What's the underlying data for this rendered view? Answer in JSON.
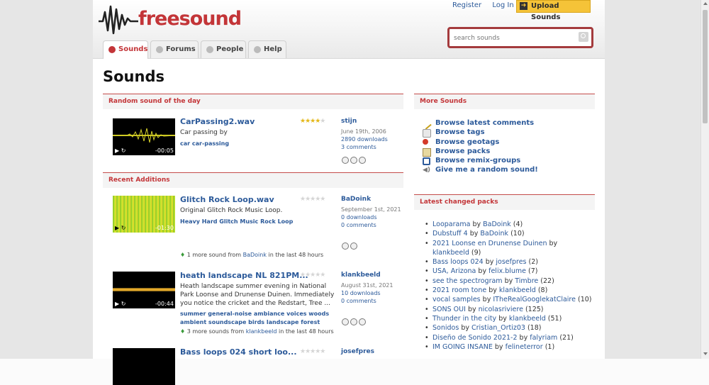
{
  "brand": {
    "logo_text": "freesound",
    "accent_color": "#c33538",
    "link_color": "#2c5a9a"
  },
  "top_links": {
    "register": "Register",
    "login": "Log In",
    "upload": "Upload Sounds"
  },
  "search": {
    "placeholder": "search sounds",
    "icon": "magnifier-icon"
  },
  "tabs": [
    {
      "label": "Sounds",
      "icon": "headphones-icon",
      "active": true
    },
    {
      "label": "Forums",
      "icon": "speech-bubble-icon",
      "active": false
    },
    {
      "label": "People",
      "icon": "people-icon",
      "active": false
    },
    {
      "label": "Help",
      "icon": "question-icon",
      "active": false
    }
  ],
  "page_title": "Sounds",
  "random_sound": {
    "heading": "Random sound of the day",
    "title": "CarPassing2.wav",
    "description": "Car passing by",
    "tags": "car car-passing",
    "user": "stijn",
    "date": "June 19th, 2006",
    "downloads": "2890 downloads",
    "comments": "3 comments",
    "duration": "-00:05",
    "rating": 4
  },
  "recent": {
    "heading": "Recent Additions",
    "items": [
      {
        "title": "Glitch Rock Loop.wav",
        "description": "Original Glitch Rock Music Loop.",
        "tags": "Heavy Hard Glitch Music Rock Loop",
        "user": "BaDoink",
        "date": "September 1st, 2021",
        "downloads": "0 downloads",
        "comments": "0 comments",
        "duration": "-01:30",
        "rating": 0,
        "more": {
          "count": "1 more sound from",
          "user": "BaDoink",
          "suffix": "in the last 48 hours"
        }
      },
      {
        "title": "heath landscape NL 821PM...",
        "description": "Heath landscape summer evening in National Park Loonse and Drunense Duinen. Immediately you notice the cricket and the Redstart, Tree ...",
        "tags": "summer general-noise ambiance voices woods ambient soundscape birds landscape forest",
        "user": "klankbeeld",
        "date": "August 31st, 2021",
        "downloads": "10 downloads",
        "comments": "0 comments",
        "duration": "-00:44",
        "rating": 0,
        "more": {
          "count": "3 more sounds from",
          "user": "klankbeeld",
          "suffix": "in the last 48 hours"
        }
      },
      {
        "title": "Bass loops 024 short loo...",
        "user": "josefpres",
        "rating": 0
      }
    ]
  },
  "more_sounds": {
    "heading": "More Sounds",
    "links": [
      {
        "label": "Browse latest comments",
        "icon": "pencil-icon"
      },
      {
        "label": "Browse tags",
        "icon": "tag-icon"
      },
      {
        "label": "Browse geotags",
        "icon": "pin-icon"
      },
      {
        "label": "Browse packs",
        "icon": "pack-icon"
      },
      {
        "label": "Browse remix-groups",
        "icon": "remix-icon"
      },
      {
        "label": "Give me a random sound!",
        "icon": "speaker-icon"
      }
    ]
  },
  "packs": {
    "heading": "Latest changed packs",
    "items": [
      {
        "name": "Looparama",
        "user": "BaDoink",
        "count": "(4)"
      },
      {
        "name": "Dubstuff 4",
        "user": "BaDoink",
        "count": "(10)"
      },
      {
        "name": "2021 Loonse en Drunense Duinen",
        "user": "klankbeeld",
        "count": "(9)"
      },
      {
        "name": "Bass loops 024",
        "user": "josefpres",
        "count": "(2)"
      },
      {
        "name": "USA, Arizona",
        "user": "felix.blume",
        "count": "(7)"
      },
      {
        "name": "see the spectrogram",
        "user": "Timbre",
        "count": "(22)"
      },
      {
        "name": "2021 room tone",
        "user": "klankbeeld",
        "count": "(8)"
      },
      {
        "name": "vocal samples",
        "user": "ITheRealGooglekatClaire",
        "count": "(10)"
      },
      {
        "name": "SONS OUI",
        "user": "nicolasriviere",
        "count": "(125)"
      },
      {
        "name": "Thunder in the city",
        "user": "klankbeeld",
        "count": "(51)"
      },
      {
        "name": "Sonidos",
        "user": "Cristian_Ortiz03",
        "count": "(18)"
      },
      {
        "name": "Diseño de Sonido 2021-2",
        "user": "falyriam",
        "count": "(21)"
      },
      {
        "name": "IM GOING INSANE",
        "user": "felineterror",
        "count": "(1)"
      }
    ],
    "by": "by"
  }
}
